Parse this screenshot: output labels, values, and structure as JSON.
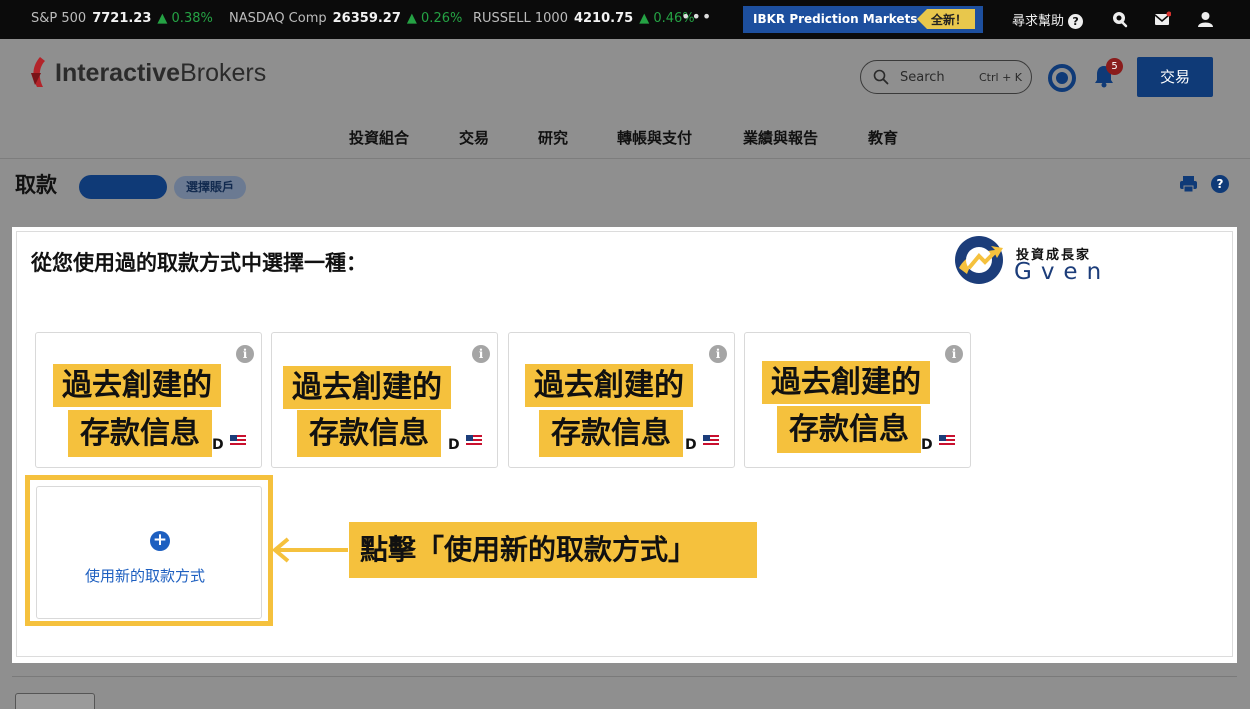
{
  "ticker": {
    "items": [
      {
        "name": "S&P 500",
        "value": "7721.23",
        "change": "▲ 0.38%"
      },
      {
        "name": "NASDAQ Comp",
        "value": "26359.27",
        "change": "▲ 0.26%"
      },
      {
        "name": "RUSSELL 1000",
        "value": "4210.75",
        "change": "▲ 0.46%"
      }
    ],
    "more": "•••",
    "promo_label": "IBKR Prediction Markets",
    "promo_badge": "全新！",
    "help_label": "尋求幫助",
    "help_q": "?"
  },
  "header": {
    "logo_a": "Interactive",
    "logo_b": "Brokers",
    "search_placeholder": "Search",
    "search_shortcut": "Ctrl + K",
    "notif_count": "5",
    "trade_button": "交易",
    "nav": [
      "投資組合",
      "交易",
      "研究",
      "轉帳與支付",
      "業績與報告",
      "教育"
    ]
  },
  "page": {
    "title": "取款",
    "select_account": "選擇賬戶",
    "help_q": "?"
  },
  "main": {
    "heading": "從您使用過的取款方式中選擇一種：",
    "watermark_line1": "投資成長家",
    "watermark_line2": "Gven",
    "card_info": "i",
    "card_suffix": "D",
    "overlay_line1": "過去創建的",
    "overlay_line2": "存款信息",
    "new_method_plus": "+",
    "new_method_label": "使用新的取款方式",
    "callout": "點擊「使用新的取款方式」"
  },
  "colors": {
    "brand_navy": "#0f3a77",
    "highlight": "#f5c13d",
    "link_blue": "#1d5fc0",
    "up_green": "#25a244"
  }
}
